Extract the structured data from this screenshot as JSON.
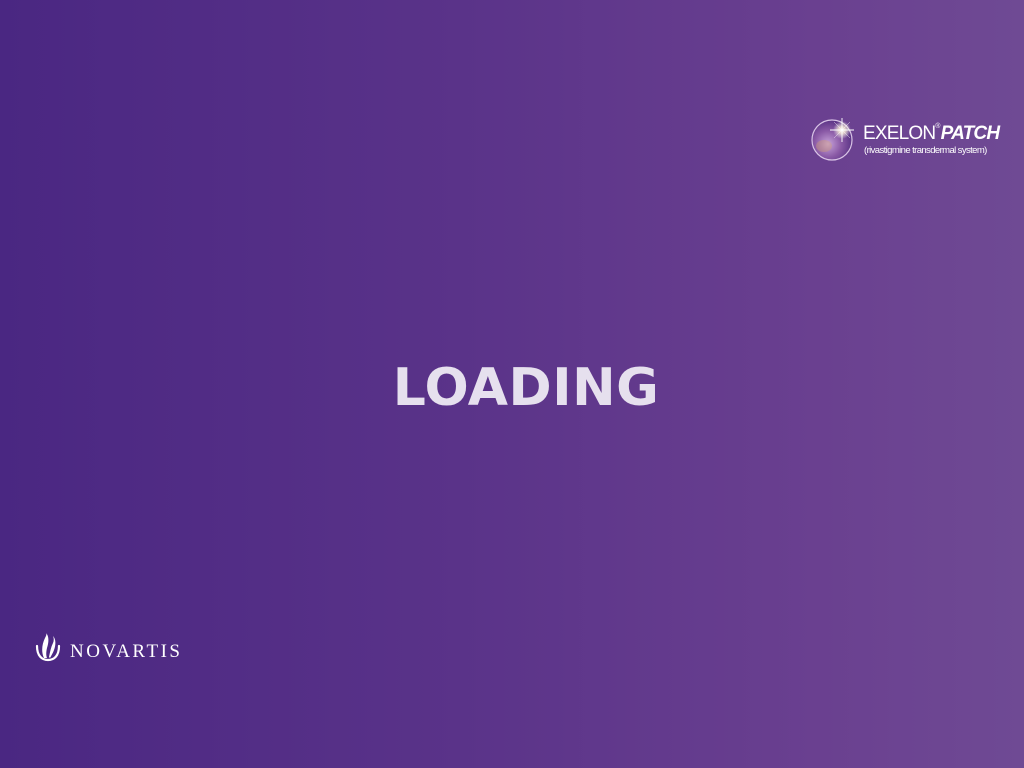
{
  "screen": {
    "loading_label": "LOADING"
  },
  "brand": {
    "name_main": "EXELON",
    "registered_mark": "®",
    "name_sub": "PATCH",
    "subtitle": "(rivastigmine transdermal system)",
    "orb_icon": "glowing-orb-icon"
  },
  "company": {
    "name": "NOVARTIS",
    "mark_icon": "novartis-flame-icon"
  },
  "colors": {
    "background_start": "#4a2782",
    "background_end": "#6f4a94",
    "loading_text": "#e6e0ee",
    "logo_text": "#ffffff"
  }
}
